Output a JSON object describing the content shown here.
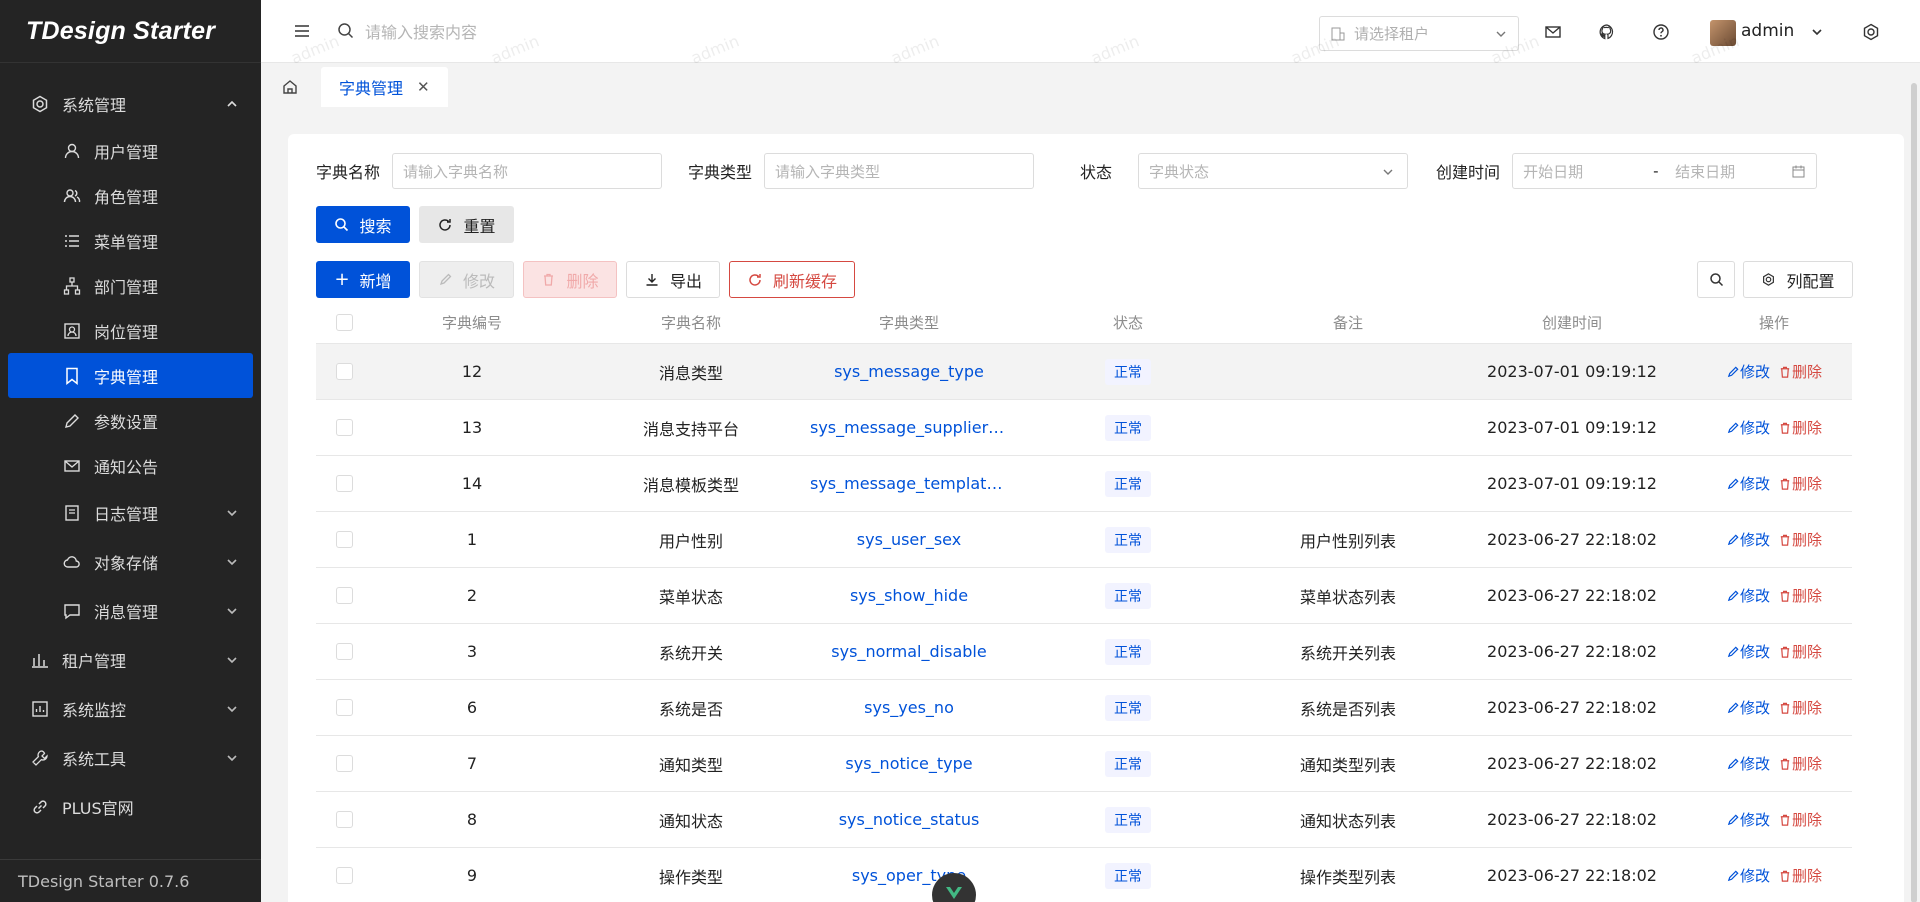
{
  "app": {
    "logo_text": "TDesign Starter",
    "version": "TDesign Starter 0.7.6"
  },
  "sidebar": {
    "items": [
      {
        "label": "系统管理",
        "level": "top",
        "icon": "settings-icon",
        "expanded": true
      },
      {
        "label": "用户管理",
        "level": "sub",
        "icon": "user-icon"
      },
      {
        "label": "角色管理",
        "level": "sub",
        "icon": "usergroup-icon"
      },
      {
        "label": "菜单管理",
        "level": "sub",
        "icon": "menu-list-icon"
      },
      {
        "label": "部门管理",
        "level": "sub",
        "icon": "org-tree-icon"
      },
      {
        "label": "岗位管理",
        "level": "sub",
        "icon": "user-card-icon"
      },
      {
        "label": "字典管理",
        "level": "sub",
        "icon": "bookmark-icon",
        "active": true
      },
      {
        "label": "参数设置",
        "level": "sub",
        "icon": "edit-icon"
      },
      {
        "label": "通知公告",
        "level": "sub",
        "icon": "mail-icon"
      },
      {
        "label": "日志管理",
        "level": "sub",
        "icon": "file-icon",
        "has_children": true
      },
      {
        "label": "对象存储",
        "level": "sub",
        "icon": "cloud-icon",
        "has_children": true
      },
      {
        "label": "消息管理",
        "level": "sub",
        "icon": "chat-icon",
        "has_children": true
      },
      {
        "label": "租户管理",
        "level": "top",
        "icon": "chart-bar-icon",
        "has_children": true
      },
      {
        "label": "系统监控",
        "level": "top",
        "icon": "monitor-icon",
        "has_children": true
      },
      {
        "label": "系统工具",
        "level": "top",
        "icon": "tool-icon",
        "has_children": true
      },
      {
        "label": "PLUS官网",
        "level": "top",
        "icon": "link-icon"
      }
    ]
  },
  "header": {
    "search_placeholder": "请输入搜索内容",
    "tenant_placeholder": "请选择租户",
    "username": "admin"
  },
  "tabs": [
    {
      "label": "字典管理",
      "active": true
    }
  ],
  "filters": {
    "dict_name_label": "字典名称",
    "dict_name_placeholder": "请输入字典名称",
    "dict_type_label": "字典类型",
    "dict_type_placeholder": "请输入字典类型",
    "status_label": "状态",
    "status_placeholder": "字典状态",
    "created_label": "创建时间",
    "start_placeholder": "开始日期",
    "range_sep": "-",
    "end_placeholder": "结束日期"
  },
  "buttons": {
    "search": "搜索",
    "reset": "重置",
    "add": "新增",
    "edit": "修改",
    "delete": "删除",
    "export": "导出",
    "refresh_cache": "刷新缓存",
    "column_config": "列配置"
  },
  "table": {
    "columns": [
      "字典编号",
      "字典名称",
      "字典类型",
      "状态",
      "备注",
      "创建时间",
      "操作"
    ],
    "op_edit": "修改",
    "op_delete": "删除",
    "rows": [
      {
        "id": "12",
        "name": "消息类型",
        "type": "sys_message_type",
        "status": "正常",
        "remark": "",
        "created": "2023-07-01 09:19:12"
      },
      {
        "id": "13",
        "name": "消息支持平台",
        "type": "sys_message_supplier_...",
        "status": "正常",
        "remark": "",
        "created": "2023-07-01 09:19:12"
      },
      {
        "id": "14",
        "name": "消息模板类型",
        "type": "sys_message_template...",
        "status": "正常",
        "remark": "",
        "created": "2023-07-01 09:19:12"
      },
      {
        "id": "1",
        "name": "用户性别",
        "type": "sys_user_sex",
        "status": "正常",
        "remark": "用户性别列表",
        "created": "2023-06-27 22:18:02"
      },
      {
        "id": "2",
        "name": "菜单状态",
        "type": "sys_show_hide",
        "status": "正常",
        "remark": "菜单状态列表",
        "created": "2023-06-27 22:18:02"
      },
      {
        "id": "3",
        "name": "系统开关",
        "type": "sys_normal_disable",
        "status": "正常",
        "remark": "系统开关列表",
        "created": "2023-06-27 22:18:02"
      },
      {
        "id": "6",
        "name": "系统是否",
        "type": "sys_yes_no",
        "status": "正常",
        "remark": "系统是否列表",
        "created": "2023-06-27 22:18:02"
      },
      {
        "id": "7",
        "name": "通知类型",
        "type": "sys_notice_type",
        "status": "正常",
        "remark": "通知类型列表",
        "created": "2023-06-27 22:18:02"
      },
      {
        "id": "8",
        "name": "通知状态",
        "type": "sys_notice_status",
        "status": "正常",
        "remark": "通知状态列表",
        "created": "2023-06-27 22:18:02"
      },
      {
        "id": "9",
        "name": "操作类型",
        "type": "sys_oper_type",
        "status": "正常",
        "remark": "操作类型列表",
        "created": "2023-06-27 22:18:02"
      }
    ]
  },
  "watermark": "admin",
  "colors": {
    "brand": "#0052d9",
    "danger": "#d54941",
    "sidebar_bg": "#242424"
  }
}
